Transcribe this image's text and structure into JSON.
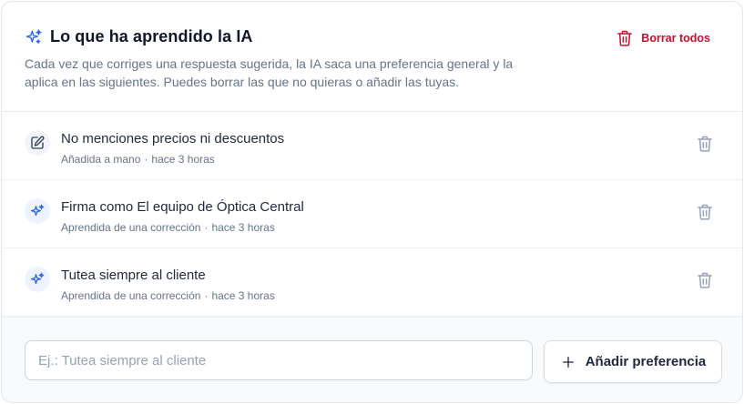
{
  "header": {
    "title": "Lo que ha aprendido la IA",
    "description": "Cada vez que corriges una respuesta sugerida, la IA saca una preferencia general y la aplica en las siguientes. Puedes borrar las que no quieras o añadir las tuyas.",
    "clear_all_label": "Borrar todos"
  },
  "preferences": [
    {
      "text": "No menciones precios ni descuentos",
      "source": "Añadida a mano",
      "time": "hace 3 horas",
      "icon": "pencil-icon"
    },
    {
      "text": "Firma como El equipo de Óptica Central",
      "source": "Aprendida de una corrección",
      "time": "hace 3 horas",
      "icon": "sparkle-icon"
    },
    {
      "text": "Tutea siempre al cliente",
      "source": "Aprendida de una corrección",
      "time": "hace 3 horas",
      "icon": "sparkle-icon"
    }
  ],
  "meta_separator": "·",
  "footer": {
    "input_value": "",
    "input_placeholder": "Ej.: Tutea siempre al cliente",
    "add_label": "Añadir preferencia"
  },
  "colors": {
    "accent": "#2563eb",
    "danger": "#c8102e",
    "muted_text": "#64748b"
  }
}
